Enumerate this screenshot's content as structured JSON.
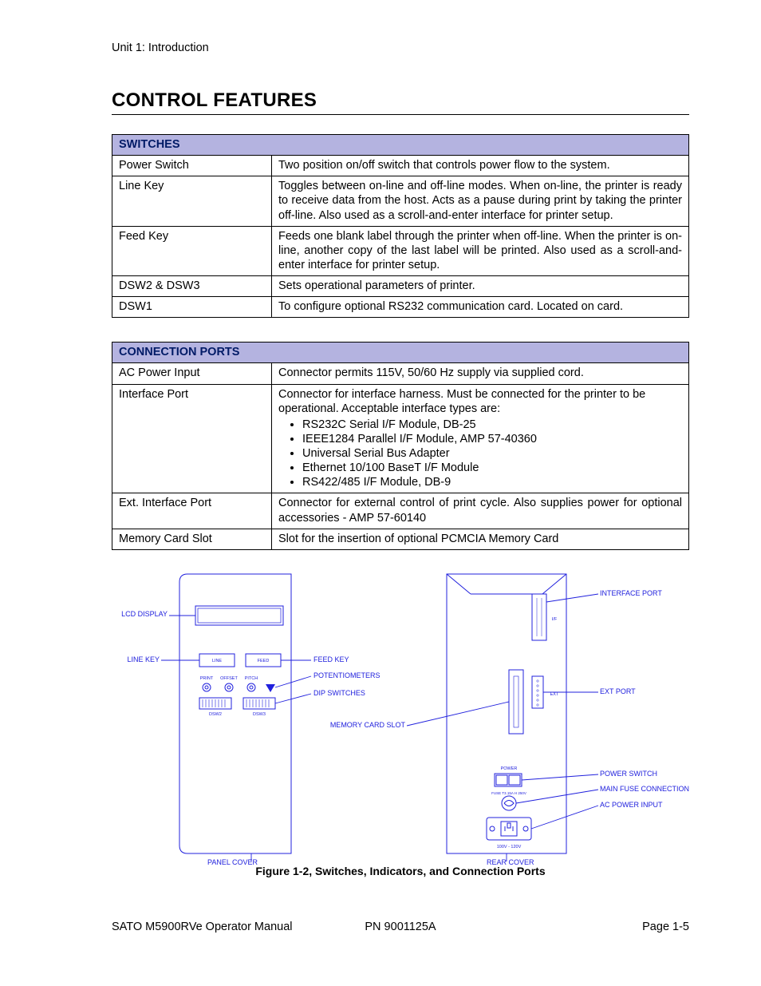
{
  "page": {
    "unit_header": "Unit 1: Introduction",
    "section_title": "CONTROL FEATURES",
    "figure_caption": "Figure 1-2, Switches, Indicators, and Connection Ports"
  },
  "tables": {
    "switches": {
      "header": "Switches",
      "rows": [
        {
          "name": "Power Switch",
          "desc": "Two position on/off switch that controls power flow to the system."
        },
        {
          "name": "Line Key",
          "desc": "Toggles between on-line and off-line modes. When on-line, the printer is ready to receive data from the host. Acts as a pause during print by taking the printer off-line. Also used as a scroll-and-enter interface for printer setup."
        },
        {
          "name": "Feed Key",
          "desc": "Feeds one blank label through the printer when off-line. When the printer is on-line, another copy of the last label will be printed. Also used as a scroll-and-enter interface for printer setup."
        },
        {
          "name": "DSW2 & DSW3",
          "desc": "Sets operational parameters of printer."
        },
        {
          "name": "DSW1",
          "desc": "To configure optional RS232 communication card. Located on card."
        }
      ]
    },
    "ports": {
      "header": "Connection Ports",
      "rows": [
        {
          "name": "AC Power Input",
          "desc": "Connector permits 115V, 50/60 Hz supply via supplied cord."
        },
        {
          "name": "Interface Port",
          "desc_prefix": "Connector for interface harness. Must be connected for the printer to be operational. Acceptable interface types are:",
          "bullets": [
            "RS232C Serial I/F Module, DB-25",
            "IEEE1284 Parallel I/F Module, AMP 57-40360",
            "Universal Serial Bus Adapter",
            "Ethernet 10/100 BaseT I/F Module",
            "RS422/485 I/F Module, DB-9"
          ]
        },
        {
          "name": "Ext. Interface Port",
          "desc": "Connector for external control of print cycle. Also supplies power for optional accessories - AMP 57-60140"
        },
        {
          "name": "Memory Card Slot",
          "desc": "Slot for the insertion of optional PCMCIA Memory Card"
        }
      ]
    }
  },
  "figure": {
    "labels": {
      "lcd_display": "LCD DISPLAY",
      "line_key": "LINE KEY",
      "feed_key": "FEED KEY",
      "potentiometers": "POTENTIOMETERS",
      "dip_switches": "DIP SWITCHES",
      "memory_card_slot": "MEMORY CARD SLOT",
      "panel_cover": "PANEL COVER",
      "interface_port": "INTERFACE PORT",
      "ext_port": "EXT PORT",
      "power_switch": "POWER SWITCH",
      "main_fuse": "MAIN FUSE CONNECTION",
      "ac_power": "AC POWER INPUT",
      "rear_cover": "REAR COVER"
    },
    "inner_text": {
      "line": "LINE",
      "feed": "FEED",
      "print": "PRINT",
      "offset": "OFFSET",
      "pitch": "PITCH",
      "dsw2": "DSW2",
      "dsw3": "DSW3",
      "if": "I/F",
      "ext": "EXT",
      "power": "POWER",
      "fuse": "FUSE T3.15A H 250V",
      "volts": "100V - 120V"
    }
  },
  "footer": {
    "left": "SATO M5900RVe Operator Manual",
    "center": "PN 9001125A",
    "right": "Page 1-5"
  }
}
